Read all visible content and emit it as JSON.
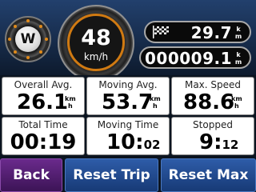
{
  "compass": {
    "heading": "W"
  },
  "speedometer": {
    "value": "48",
    "unit": "km/h"
  },
  "trip_odometer": {
    "value": "29.7",
    "unit_top": "k",
    "unit_bottom": "m",
    "icon": "checkered-flag-icon"
  },
  "odometer": {
    "value": "000009.1",
    "unit_top": "k",
    "unit_bottom": "m"
  },
  "stats": [
    {
      "label": "Overall Avg.",
      "value": "26.1",
      "unit_top": "km",
      "unit_bottom": "h"
    },
    {
      "label": "Moving Avg.",
      "value": "53.7",
      "unit_top": "km",
      "unit_bottom": "h"
    },
    {
      "label": "Max. Speed",
      "value": "88.6",
      "unit_top": "km",
      "unit_bottom": "h"
    },
    {
      "label": "Total Time",
      "value": "00:19"
    },
    {
      "label": "Moving Time",
      "value_main": "10:",
      "value_small": "02"
    },
    {
      "label": "Stopped",
      "value_main": "9:",
      "value_small": "12"
    }
  ],
  "buttons": {
    "back": "Back",
    "reset_trip": "Reset Trip",
    "reset_max": "Reset Max"
  },
  "colors": {
    "accent": "#d07a12",
    "back_button": "#5a2280",
    "action_button": "#24509a"
  }
}
